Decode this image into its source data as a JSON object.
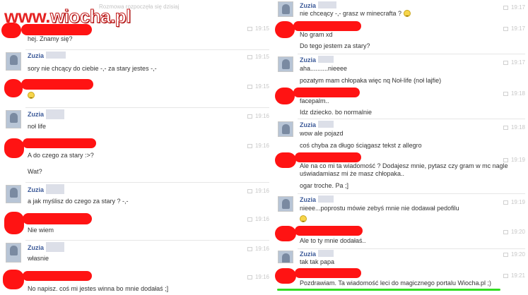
{
  "watermark": {
    "part1": "www.",
    "part2": "wiocha.pl"
  },
  "header_note": "Rozmowa rozpoczęła się dzisiaj",
  "left_column": [
    {
      "sender": "",
      "lines": [
        "hej. Znamy się?"
      ],
      "time": "19:15"
    },
    {
      "sender": "Zuzia",
      "lines": [
        "sory nie chcący do ciebie -,- za stary jestes -,-"
      ],
      "time": "19:15"
    },
    {
      "sender": "",
      "lines": [
        ""
      ],
      "emoticon": "smiley",
      "time": "19:15"
    },
    {
      "sender": "Zuzia",
      "lines": [
        "noł life"
      ],
      "time": "19:16"
    },
    {
      "sender": "",
      "lines": [
        "A do czego za stary :>?",
        "Wat?"
      ],
      "time": "19:16"
    },
    {
      "sender": "Zuzia",
      "lines": [
        "a jak myślisz do czego za stary ? -,-"
      ],
      "time": "19:16"
    },
    {
      "sender": "",
      "lines": [
        "Nie wiem"
      ],
      "time": "19:16"
    },
    {
      "sender": "Zuzia",
      "lines": [
        "własnie"
      ],
      "time": "19:16"
    },
    {
      "sender": "",
      "lines": [
        "No napisz. coś mi jestes winna bo mnie dodałaś ;]"
      ],
      "time": "19:16"
    }
  ],
  "right_column": [
    {
      "sender": "Zuzia",
      "lines": [
        "nie chceący -,- grasz w minecrafta ?"
      ],
      "emoticon_inline": "smiley",
      "time": "19:17"
    },
    {
      "sender": "",
      "lines": [
        "No gram xd",
        "Do tego jestem za stary?"
      ],
      "time": "19:17"
    },
    {
      "sender": "Zuzia",
      "lines": [
        "aha..........nieeee",
        "pozatym mam chłopaka więc nq Noł-life (noł lajfie)"
      ],
      "time": "19:17"
    },
    {
      "sender": "",
      "lines": [
        "facepalm..",
        "Idz dziecko. bo normalnie"
      ],
      "time": "19:18"
    },
    {
      "sender": "Zuzia",
      "lines": [
        "wow ale pojazd",
        "coś chyba za długo ściągasz tekst z allegro"
      ],
      "time": "19:18"
    },
    {
      "sender": "",
      "lines": [
        "Ale na co mi ta wiadomość ? Dodajesz mnie, pytasz czy gram w mc nagle uświadamiasz mi że masz chłopaka..",
        "ogar troche. Pa ;]"
      ],
      "time": "19:19"
    },
    {
      "sender": "Zuzia",
      "lines": [
        "nieee...poprostu mówie zebyś mnie nie dodawał pedofilu"
      ],
      "emoticon": "smiley",
      "time": "19:19"
    },
    {
      "sender": "",
      "lines": [
        "Ale to ty mnie dodałaś.."
      ],
      "time": "19:20"
    },
    {
      "sender": "Zuzia",
      "lines": [
        "tak tak papa"
      ],
      "time": "19:20"
    },
    {
      "sender": "",
      "lines": [
        "Pozdrawiam. Ta wiadomość leci do magicznego portalu Wiocha.pl ;)"
      ],
      "time": "19:21"
    }
  ]
}
